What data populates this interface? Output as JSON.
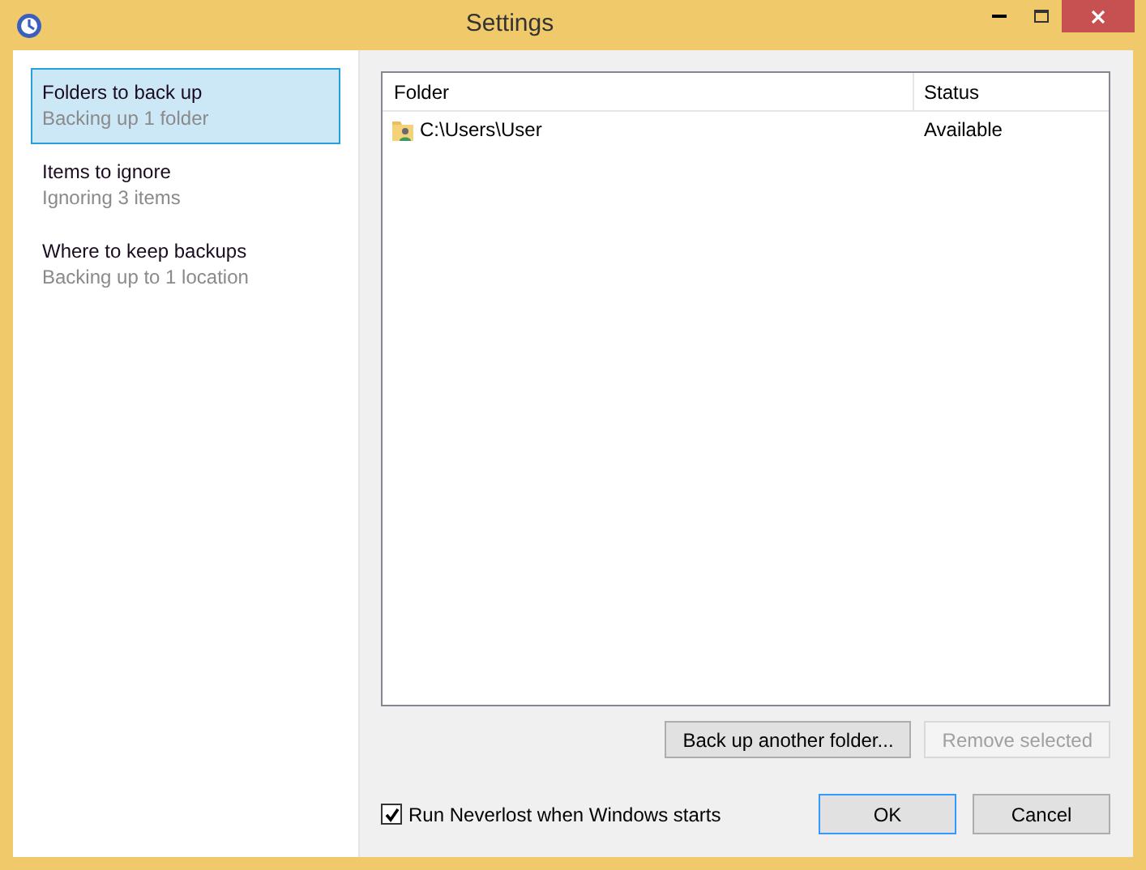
{
  "window": {
    "title": "Settings"
  },
  "sidebar": {
    "items": [
      {
        "title": "Folders to back up",
        "subtitle": "Backing up 1 folder",
        "selected": true
      },
      {
        "title": "Items to ignore",
        "subtitle": "Ignoring 3 items",
        "selected": false
      },
      {
        "title": "Where to keep backups",
        "subtitle": "Backing up to 1 location",
        "selected": false
      }
    ]
  },
  "table": {
    "columns": [
      "Folder",
      "Status"
    ],
    "rows": [
      {
        "folder": "C:\\Users\\User",
        "status": "Available",
        "selected": false
      }
    ]
  },
  "list_buttons": [
    {
      "label": "Back up another folder...",
      "disabled": false
    },
    {
      "label": "Remove selected",
      "disabled": true
    }
  ],
  "startup_checkbox": {
    "label": "Run Neverlost when Windows starts",
    "checked": true
  },
  "dialog_buttons": [
    {
      "label": "OK",
      "default": true
    },
    {
      "label": "Cancel",
      "default": false
    }
  ]
}
